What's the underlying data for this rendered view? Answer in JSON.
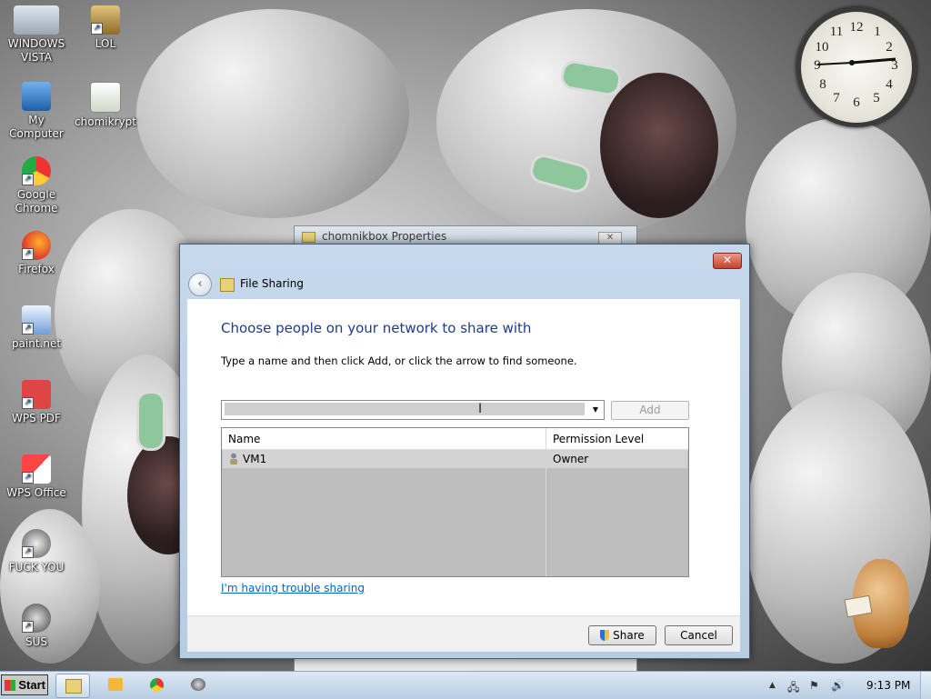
{
  "desktop": {
    "icons": [
      {
        "label": "WINDOWS VISTA"
      },
      {
        "label": "LOL"
      },
      {
        "label": "My Computer"
      },
      {
        "label": "chomikrypt"
      },
      {
        "label": "Google Chrome"
      },
      {
        "label": "Firefox"
      },
      {
        "label": "paint.net"
      },
      {
        "label": "WPS PDF"
      },
      {
        "label": "WPS Office"
      },
      {
        "label": "FUCK YOU"
      },
      {
        "label": "SUS"
      }
    ],
    "clock_numbers": [
      "12",
      "1",
      "2",
      "3",
      "4",
      "5",
      "6",
      "7",
      "8",
      "9",
      "10",
      "11"
    ]
  },
  "background_window": {
    "title": "chomnikbox Properties",
    "close_label": "✕"
  },
  "dialog": {
    "close_label": "✕",
    "back_label": "‹",
    "title": "File Sharing",
    "heading": "Choose people on your network to share with",
    "instruction": "Type a name and then click Add, or click the arrow to find someone.",
    "name_input_value": "",
    "add_label": "Add",
    "columns": {
      "name": "Name",
      "permission": "Permission Level"
    },
    "rows": [
      {
        "name": "VM1",
        "permission": "Owner"
      }
    ],
    "trouble_link": "I'm having trouble sharing",
    "share_label": "Share",
    "cancel_label": "Cancel"
  },
  "taskbar": {
    "start_label": "Start",
    "time": "9:13 PM",
    "show_hidden": "▲"
  },
  "colors": {
    "heading": "#1e3c8c",
    "link": "#0066cc",
    "close_button": "#c8402a"
  }
}
